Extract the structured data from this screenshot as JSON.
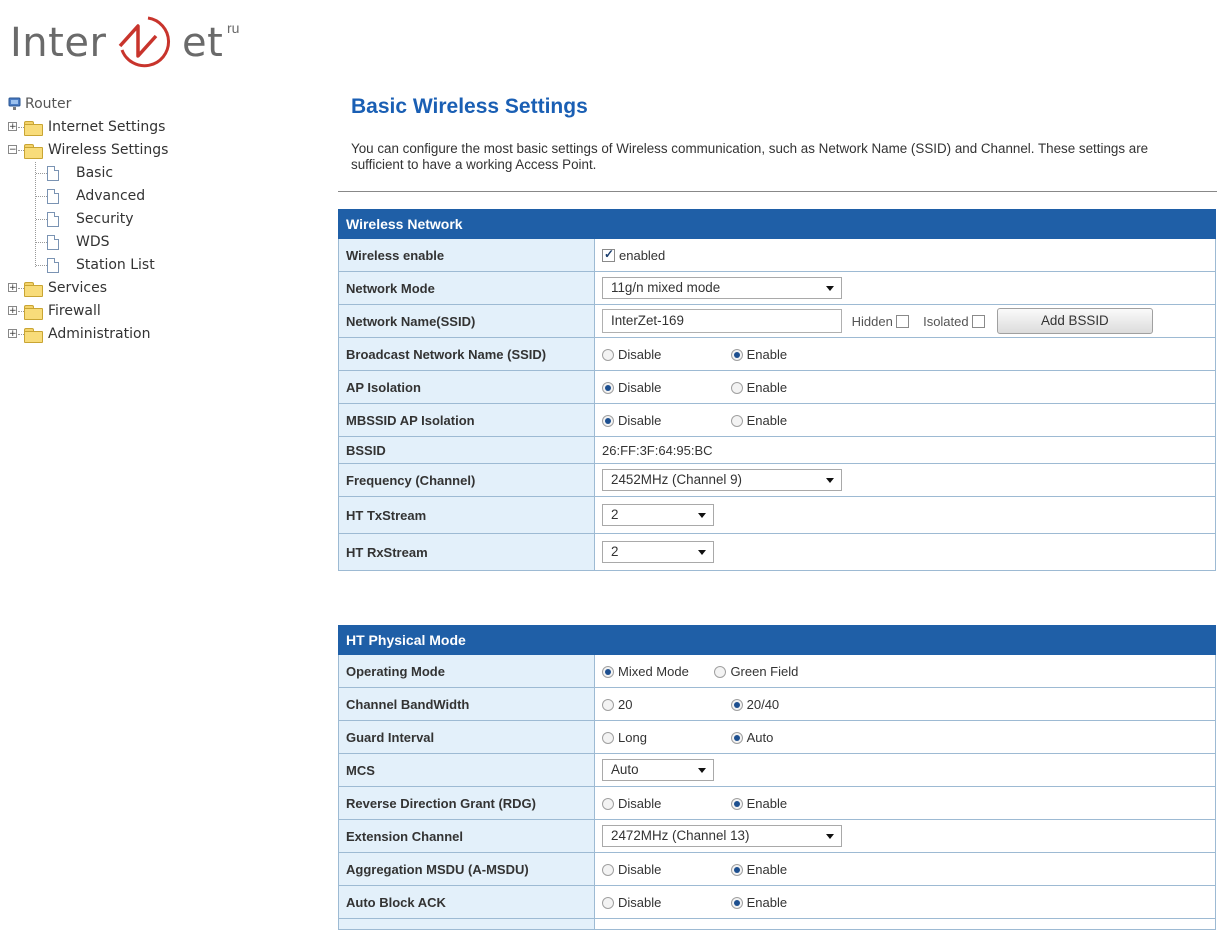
{
  "logo": {
    "left": "Inter",
    "right": "et",
    "sup": "ru"
  },
  "tree": {
    "router": "Router",
    "internet": "Internet Settings",
    "wireless": "Wireless Settings",
    "children": [
      "Basic",
      "Advanced",
      "Security",
      "WDS",
      "Station List"
    ],
    "services": "Services",
    "firewall": "Firewall",
    "administration": "Administration",
    "collapsed_glyph": "+",
    "expanded_glyph": "−"
  },
  "page": {
    "title": "Basic Wireless Settings",
    "description": "You can configure the most basic settings of Wireless communication, such as Network Name (SSID) and Channel. These settings are sufficient to have a working Access Point."
  },
  "wireless_network": {
    "header": "Wireless Network",
    "wireless_enable": {
      "label": "Wireless enable",
      "checkbox_label": "enabled",
      "checked": true
    },
    "network_mode": {
      "label": "Network Mode",
      "value": "11g/n mixed mode"
    },
    "ssid": {
      "label": "Network Name(SSID)",
      "value": "InterZet-169",
      "hidden_label": "Hidden",
      "isolated_label": "Isolated",
      "add_button": "Add BSSID"
    },
    "broadcast": {
      "label": "Broadcast Network Name (SSID)",
      "opt1": "Disable",
      "opt2": "Enable",
      "selected": "Enable"
    },
    "ap_isolation": {
      "label": "AP Isolation",
      "opt1": "Disable",
      "opt2": "Enable",
      "selected": "Disable"
    },
    "mbssid_isolation": {
      "label": "MBSSID AP Isolation",
      "opt1": "Disable",
      "opt2": "Enable",
      "selected": "Disable"
    },
    "bssid": {
      "label": "BSSID",
      "value": "26:FF:3F:64:95:BC"
    },
    "frequency": {
      "label": "Frequency (Channel)",
      "value": "2452MHz (Channel 9)"
    },
    "tx_stream": {
      "label": "HT TxStream",
      "value": "2"
    },
    "rx_stream": {
      "label": "HT RxStream",
      "value": "2"
    }
  },
  "ht_physical": {
    "header": "HT Physical Mode",
    "operating_mode": {
      "label": "Operating Mode",
      "opt1": "Mixed Mode",
      "opt2": "Green Field",
      "selected": "Mixed Mode"
    },
    "bandwidth": {
      "label": "Channel BandWidth",
      "opt1": "20",
      "opt2": "20/40",
      "selected": "20/40"
    },
    "guard": {
      "label": "Guard Interval",
      "opt1": "Long",
      "opt2": "Auto",
      "selected": "Auto"
    },
    "mcs": {
      "label": "MCS",
      "value": "Auto"
    },
    "rdg": {
      "label": "Reverse Direction Grant (RDG)",
      "opt1": "Disable",
      "opt2": "Enable",
      "selected": "Enable"
    },
    "ext_channel": {
      "label": "Extension Channel",
      "value": "2472MHz (Channel 13)"
    },
    "amsdu": {
      "label": "Aggregation MSDU (A-MSDU)",
      "opt1": "Disable",
      "opt2": "Enable",
      "selected": "Enable"
    },
    "auto_block_ack": {
      "label": "Auto Block ACK",
      "opt1": "Disable",
      "opt2": "Enable",
      "selected": "Enable"
    }
  },
  "colors": {
    "accent": "#1f5fa7",
    "title": "#1a5fb4",
    "label_bg": "#e3f0fa",
    "logo_red": "#c8342c"
  }
}
